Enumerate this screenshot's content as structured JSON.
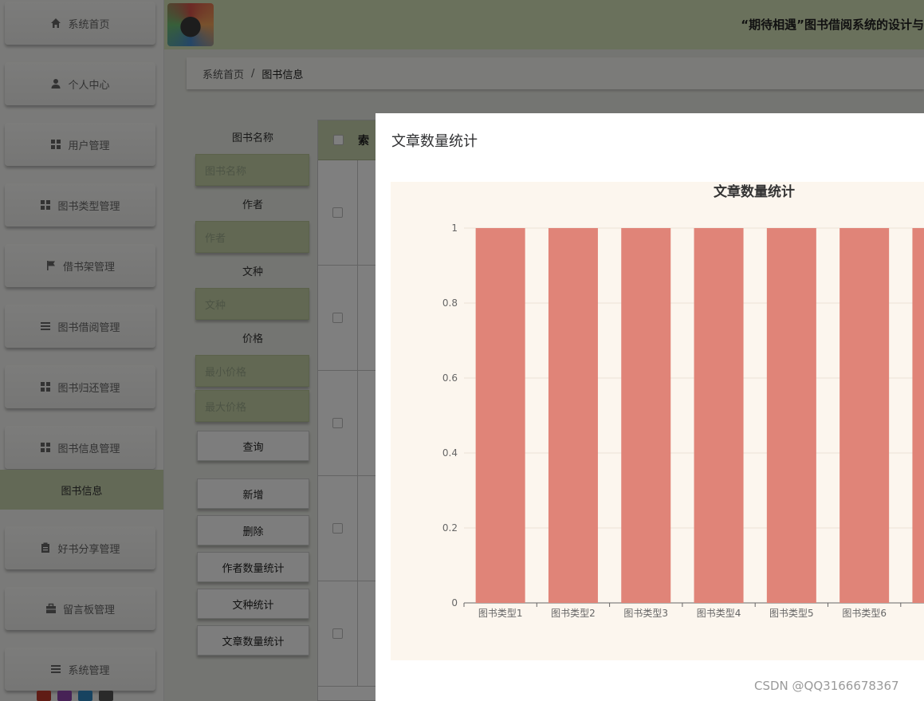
{
  "sidebar": {
    "items": [
      {
        "label": "系统首页",
        "icon": "home-icon"
      },
      {
        "label": "个人中心",
        "icon": "user-icon"
      },
      {
        "label": "用户管理",
        "icon": "grid-icon"
      },
      {
        "label": "图书类型管理",
        "icon": "grid-icon"
      },
      {
        "label": "借书架管理",
        "icon": "flag-icon"
      },
      {
        "label": "图书借阅管理",
        "icon": "list-icon"
      },
      {
        "label": "图书归还管理",
        "icon": "grid-icon"
      },
      {
        "label": "图书信息管理",
        "icon": "grid-icon"
      },
      {
        "label": "好书分享管理",
        "icon": "clipboard-icon"
      },
      {
        "label": "留言板管理",
        "icon": "briefcase-icon"
      },
      {
        "label": "系统管理",
        "icon": "list-icon"
      }
    ],
    "active_sub": "图书信息"
  },
  "header": {
    "title": "“期待相遇”图书借阅系统的设计与"
  },
  "breadcrumb": {
    "home": "系统首页",
    "separator": "/",
    "current": "图书信息"
  },
  "search": {
    "book_name_label": "图书名称",
    "book_name_placeholder": "图书名称",
    "author_label": "作者",
    "author_placeholder": "作者",
    "language_label": "文种",
    "language_placeholder": "文种",
    "price_label": "价格",
    "min_price_placeholder": "最小价格",
    "max_price_placeholder": "最大价格",
    "query_button": "查询"
  },
  "actions": {
    "add": "新增",
    "delete": "删除",
    "author_stats": "作者数量统计",
    "language_stats": "文种统计",
    "article_stats": "文章数量统计"
  },
  "table": {
    "first_col_header": "索"
  },
  "dialog": {
    "title": "文章数量统计"
  },
  "chart_data": {
    "type": "bar",
    "title": "文章数量统计",
    "categories": [
      "图书类型1",
      "图书类型2",
      "图书类型3",
      "图书类型4",
      "图书类型5",
      "图书类型6",
      "图"
    ],
    "values": [
      1,
      1,
      1,
      1,
      1,
      1,
      1
    ],
    "y_ticks": [
      "0",
      "0.2",
      "0.4",
      "0.6",
      "0.8",
      "1"
    ],
    "ylim": [
      0,
      1
    ],
    "bar_color": "#e08478",
    "grid": true
  },
  "watermark": "CSDN @QQ3166678367"
}
